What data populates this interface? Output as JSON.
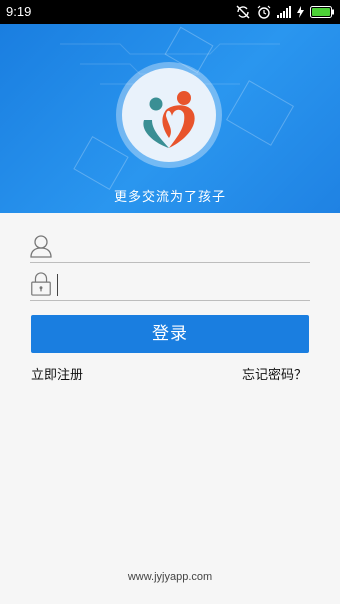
{
  "status_bar": {
    "time": "9:19",
    "icons": [
      "sync-off-icon",
      "alarm-icon",
      "signal-icon",
      "charging-icon",
      "battery-icon"
    ]
  },
  "hero": {
    "tagline": "更多交流为了孩子",
    "logo": "heart-family-logo"
  },
  "form": {
    "username_placeholder": "",
    "password_placeholder": "",
    "login_label": "登录"
  },
  "links": {
    "register": "立即注册",
    "forgot": "忘记密码？"
  },
  "footer": {
    "website": "www.jyjyapp.com"
  },
  "colors": {
    "primary": "#1a7ee0",
    "battery": "#4cd137",
    "logo_teal": "#3a8f94",
    "logo_orange": "#e8542c"
  }
}
